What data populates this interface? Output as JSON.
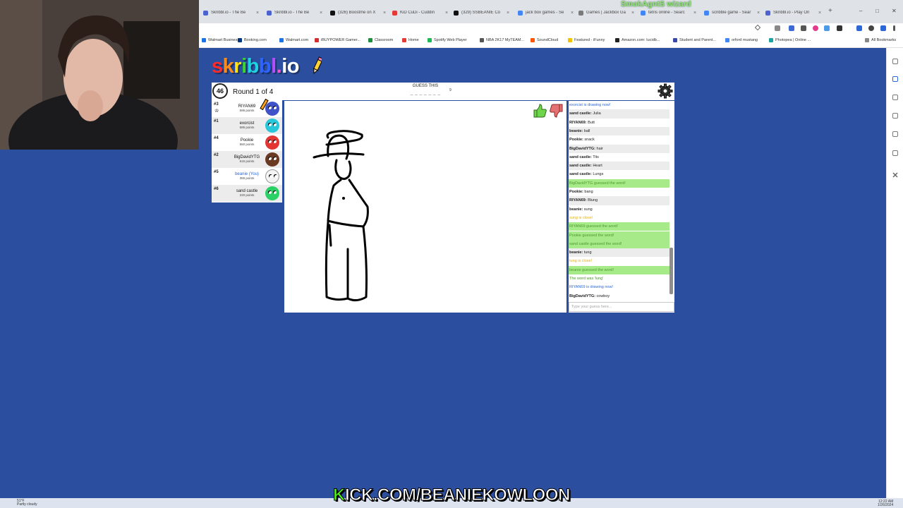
{
  "browser": {
    "tabs": [
      {
        "label": "Skribbl.io - The Be",
        "color": "#4a63d0"
      },
      {
        "label": "Skribbl.io - The Be",
        "color": "#4a63d0"
      },
      {
        "label": "(326) Boostme on X",
        "color": "#111111"
      },
      {
        "label": "KiD CuDi - Cuddin",
        "color": "#e53935"
      },
      {
        "label": "(329) SSBEANIE Co",
        "color": "#111111"
      },
      {
        "label": "jack box games - Se",
        "color": "#4285f4"
      },
      {
        "label": "Games | Jackbox Ga",
        "color": "#7a7a7a"
      },
      {
        "label": "tetris online - Searc",
        "color": "#4285f4"
      },
      {
        "label": "scribble game - Sear",
        "color": "#4285f4"
      },
      {
        "label": "Skribbl.io - Play On",
        "color": "#4a63d0"
      }
    ],
    "new_tab": "+",
    "window_controls": {
      "minimize": "–",
      "maximize": "□",
      "close": "✕"
    },
    "overlay_name": "SmokAgntS wizard",
    "bookmarks": [
      {
        "label": "Walmart Business",
        "color": "#1a73e8"
      },
      {
        "label": "Booking.com",
        "color": "#003580"
      },
      {
        "label": "Walmart.com",
        "color": "#1a73e8"
      },
      {
        "label": "iBUYPOWER Gamer...",
        "color": "#d32f2f"
      },
      {
        "label": "Classroom",
        "color": "#1e8e3e"
      },
      {
        "label": "Home",
        "color": "#e53935"
      },
      {
        "label": "Spotify Web Player",
        "color": "#1db954"
      },
      {
        "label": "NBA 2K17 MyTEAM...",
        "color": "#555555"
      },
      {
        "label": "SoundCloud",
        "color": "#ff5500"
      },
      {
        "label": "Featured - iFunny",
        "color": "#f2c200"
      },
      {
        "label": "Amazon.com: Iucidb...",
        "color": "#222222"
      },
      {
        "label": "Student and Parent...",
        "color": "#3949ab"
      },
      {
        "label": "orford mustang",
        "color": "#4285f4"
      },
      {
        "label": "Photopea | Online ...",
        "color": "#1aa3a3"
      }
    ],
    "all_bookmarks": "All Bookmarks"
  },
  "taskbar": {
    "weather_temp": "51°F",
    "weather_desc": "Partly cloudy",
    "time": "12:22 AM",
    "date": "1/26/2024"
  },
  "game": {
    "logo_letters": [
      {
        "char": "s",
        "color": "#ff2b2b"
      },
      {
        "char": "k",
        "color": "#ff8c1a"
      },
      {
        "char": "r",
        "color": "#ffe21a"
      },
      {
        "char": "i",
        "color": "#39d42c"
      },
      {
        "char": "b",
        "color": "#1fd3e0"
      },
      {
        "char": "b",
        "color": "#2d63ff"
      },
      {
        "char": "l",
        "color": "#b34dff"
      },
      {
        "char": ".",
        "color": "#ff4fd0"
      },
      {
        "char": "i",
        "color": "#ffffff"
      },
      {
        "char": "o",
        "color": "#ffffff"
      }
    ],
    "timer": "46",
    "round_text": "Round 1 of 4",
    "guess_label": "GUESS THIS",
    "word_hint": "_ _ _ _ _ _ _",
    "word_length": "9",
    "players": [
      {
        "rank": "#3",
        "name": "RIYAN69",
        "points": "595 points",
        "color": "#3f52c8",
        "you": false,
        "drawing": true
      },
      {
        "rank": "#1",
        "name": "exorcist",
        "points": "695 points",
        "color": "#27c6d8",
        "you": false,
        "drawing": false
      },
      {
        "rank": "#4",
        "name": "Pookie",
        "points": "550 points",
        "color": "#e43535",
        "you": false,
        "drawing": false
      },
      {
        "rank": "#2",
        "name": "BigDavidYTG",
        "points": "615 points",
        "color": "#6a3a22",
        "you": false,
        "drawing": false
      },
      {
        "rank": "#5",
        "name": "beanie (You)",
        "points": "355 points",
        "color": "#f4f4f4",
        "you": true,
        "drawing": false
      },
      {
        "rank": "#6",
        "name": "sand castle",
        "points": "220 points",
        "color": "#2bd166",
        "you": false,
        "drawing": false
      }
    ],
    "chat": [
      {
        "type": "info",
        "text": "exorcist is drawing now!"
      },
      {
        "type": "msg",
        "user": "sand castle:",
        "text": "Julia"
      },
      {
        "type": "msg",
        "user": "RIYAN69:",
        "text": "Butt"
      },
      {
        "type": "msg",
        "user": "beanie:",
        "text": "ball"
      },
      {
        "type": "msg",
        "user": "Pookie:",
        "text": "snack"
      },
      {
        "type": "msg",
        "user": "BigDavidYTG:",
        "text": "hair"
      },
      {
        "type": "msg",
        "user": "sand castle:",
        "text": "Tits"
      },
      {
        "type": "msg",
        "user": "sand castle:",
        "text": "Heart"
      },
      {
        "type": "msg",
        "user": "sand castle:",
        "text": "Lungs"
      },
      {
        "type": "correct",
        "text": "BigDavidYTG guessed the word!"
      },
      {
        "type": "msg",
        "user": "Pookie:",
        "text": "bang"
      },
      {
        "type": "msg",
        "user": "RIYAN69:",
        "text": "Blung"
      },
      {
        "type": "msg",
        "user": "beanie:",
        "text": "sung"
      },
      {
        "type": "close",
        "text": "sung is close!"
      },
      {
        "type": "correct",
        "text": "RIYAN69 guessed the word!"
      },
      {
        "type": "correct",
        "text": "Pookie guessed the word!"
      },
      {
        "type": "correct",
        "text": "sand castle guessed the word!"
      },
      {
        "type": "msg",
        "user": "beanie:",
        "text": "tung"
      },
      {
        "type": "close",
        "text": "tung is close!"
      },
      {
        "type": "correct",
        "text": "beanie guessed the word!"
      },
      {
        "type": "reveal",
        "text": "The word was 'lung'"
      },
      {
        "type": "info",
        "text": "RIYAN69 is drawing now!"
      },
      {
        "type": "msg",
        "user": "BigDavidYTG:",
        "text": "cowboy"
      }
    ],
    "chat_placeholder": "Type your guess here..."
  },
  "stream": {
    "banner_k": "K",
    "banner_rest": "ICK.COM/BEANIEKOWLOON"
  }
}
